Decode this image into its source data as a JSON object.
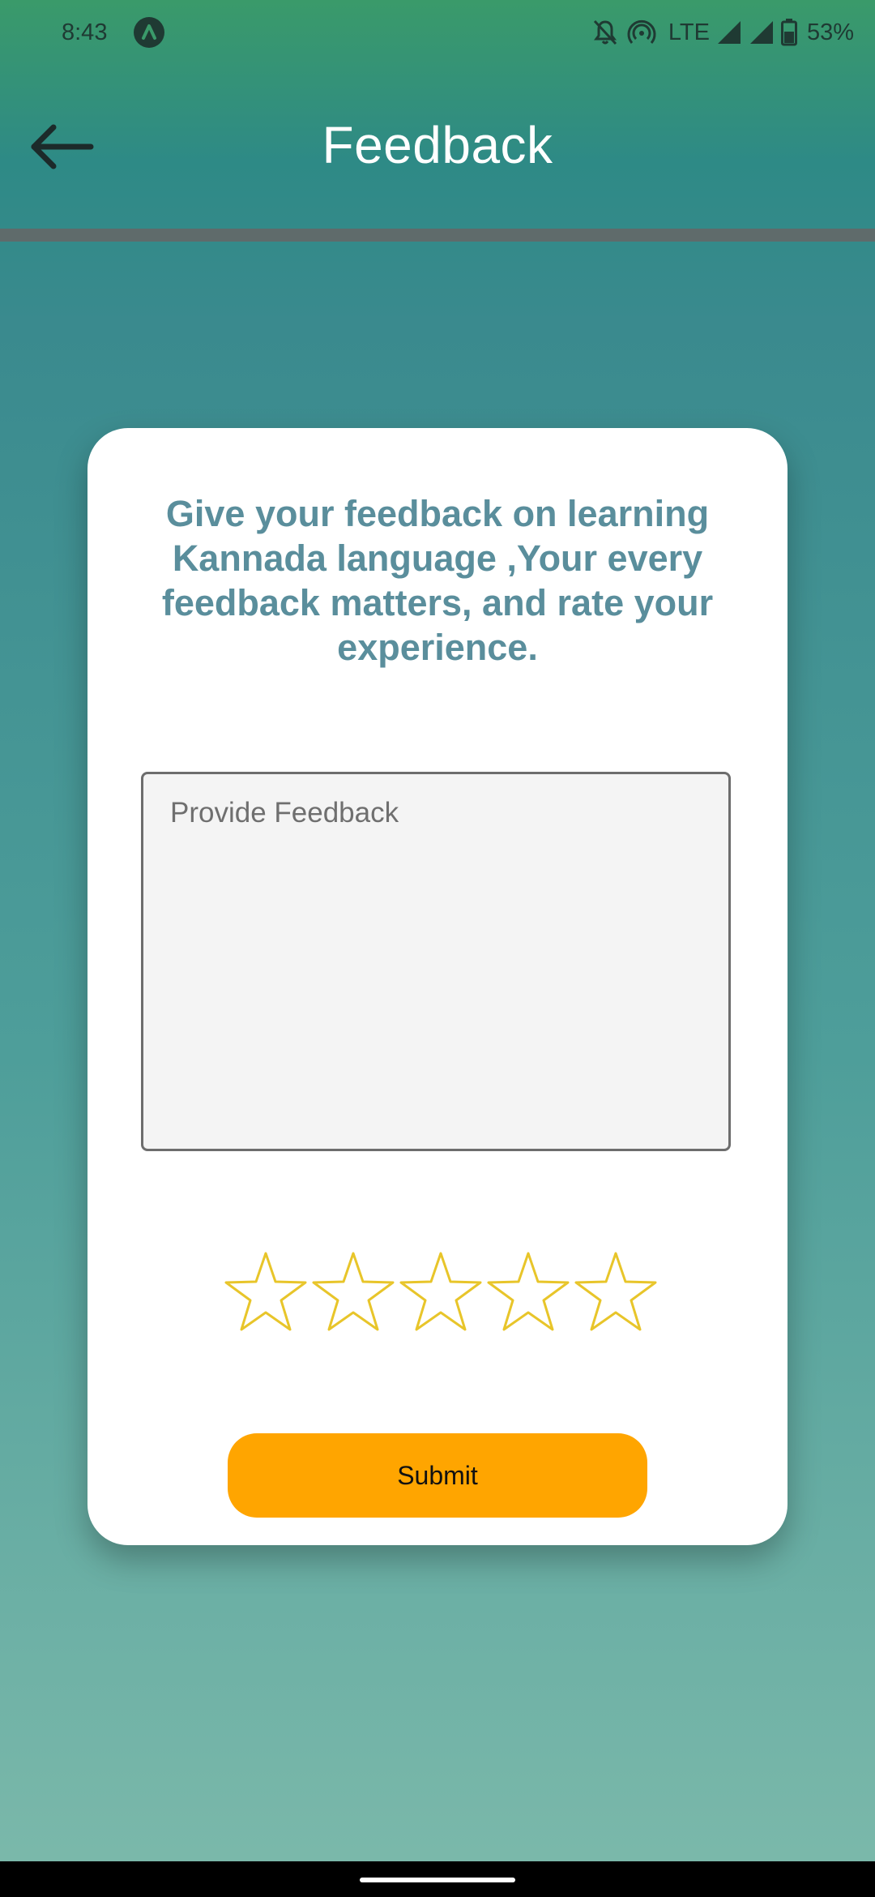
{
  "status_bar": {
    "time": "8:43",
    "network": "LTE",
    "battery": "53%"
  },
  "header": {
    "title": "Feedback",
    "back_icon": "arrow-left-icon"
  },
  "card": {
    "prompt": "Give your feedback on learning Kannada language ,Your every feedback matters, and rate your experience.",
    "feedback_input": {
      "placeholder": "Provide Feedback",
      "value": ""
    },
    "rating": {
      "max": 5,
      "value": 0,
      "star_icon": "star-outline-icon"
    },
    "submit_label": "Submit"
  },
  "colors": {
    "accent_button": "#ffa500",
    "prompt_text": "#5a8e9c",
    "star_outline": "#e8c52a",
    "divider": "#5f6b6b"
  }
}
